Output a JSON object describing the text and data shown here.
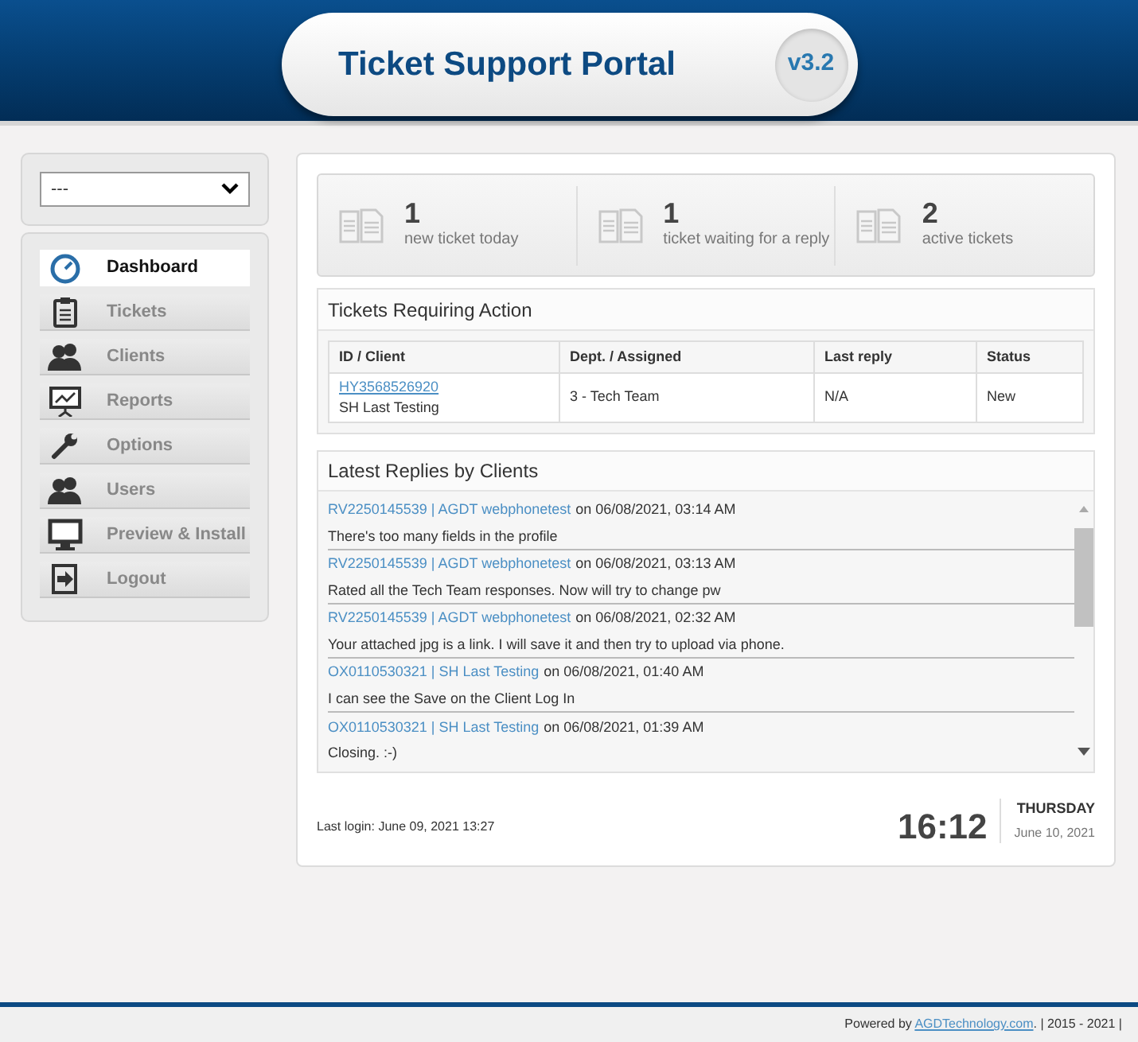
{
  "header": {
    "title": "Ticket Support Portal",
    "version": "v3.2"
  },
  "sidebar": {
    "select": {
      "value": "---"
    },
    "items": [
      {
        "label": "Dashboard",
        "kind": "gauge",
        "selected": true
      },
      {
        "label": "Tickets",
        "kind": "clipboard",
        "selected": false
      },
      {
        "label": "Clients",
        "kind": "users",
        "selected": false
      },
      {
        "label": "Reports",
        "kind": "chart",
        "selected": false
      },
      {
        "label": "Options",
        "kind": "wrench",
        "selected": false
      },
      {
        "label": "Users",
        "kind": "users",
        "selected": false
      },
      {
        "label": "Preview & Install",
        "kind": "monitor",
        "selected": false
      },
      {
        "label": "Logout",
        "kind": "logout",
        "selected": false
      }
    ]
  },
  "stats": [
    {
      "count": "1",
      "label": "new ticket today"
    },
    {
      "count": "1",
      "label": "ticket waiting for a reply"
    },
    {
      "count": "2",
      "label": "active tickets"
    }
  ],
  "tickets_panel": {
    "title": "Tickets Requiring Action",
    "columns": [
      "ID / Client",
      "Dept. / Assigned",
      "Last reply",
      "Status"
    ],
    "rows": [
      {
        "id": "HY3568526920",
        "client": "SH Last Testing",
        "dept": "3 - Tech Team",
        "last_reply": "N/A",
        "status": "New"
      }
    ]
  },
  "replies_panel": {
    "title": "Latest Replies by Clients",
    "items": [
      {
        "link": "RV2250145539 | AGDT webphonetest",
        "when": "on 06/08/2021, 03:14 AM",
        "message": "There's too many fields in the profile"
      },
      {
        "link": "RV2250145539 | AGDT webphonetest",
        "when": "on 06/08/2021, 03:13 AM",
        "message": "Rated all the Tech Team responses. Now will try to change pw"
      },
      {
        "link": "RV2250145539 | AGDT webphonetest",
        "when": "on 06/08/2021, 02:32 AM",
        "message": "Your attached jpg is a link. I will save it and then try to upload via phone."
      },
      {
        "link": "OX0110530321 | SH Last Testing",
        "when": "on 06/08/2021, 01:40 AM",
        "message": "I can see the Save on the Client Log In"
      },
      {
        "link": "OX0110530321 | SH Last Testing",
        "when": "on 06/08/2021, 01:39 AM",
        "message": "Closing. :-)"
      }
    ]
  },
  "last_login": "Last login: June 09, 2021 13:27",
  "clock": {
    "time": "16:12",
    "day": "THURSDAY",
    "date": "June 10, 2021"
  },
  "footer": {
    "prefix": "Powered by",
    "link": "AGDTechnology.com",
    "suffix": ". | 2015 - 2021 |"
  }
}
